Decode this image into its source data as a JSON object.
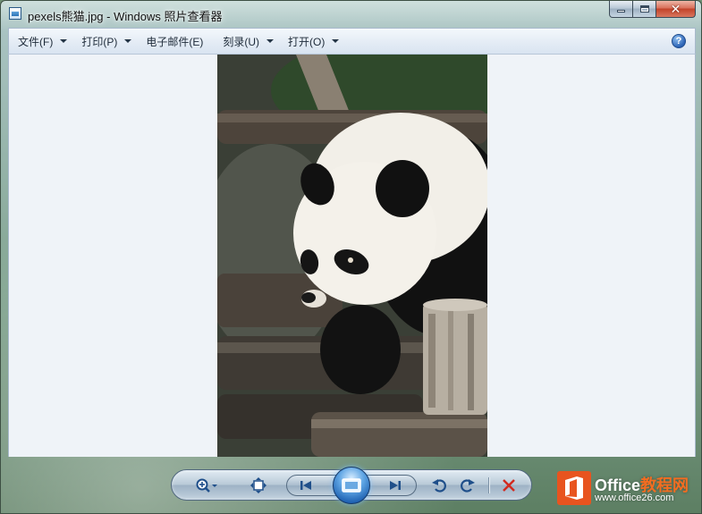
{
  "window": {
    "title": "pexels熊猫.jpg - Windows 照片查看器",
    "app_icon": "photo-viewer-icon",
    "caption_buttons": {
      "minimize": "minimize-icon",
      "maximize": "maximize-icon",
      "close": "close-icon"
    }
  },
  "menubar": {
    "items": [
      {
        "label": "文件(F)",
        "has_dropdown": true
      },
      {
        "label": "打印(P)",
        "has_dropdown": true
      },
      {
        "label": "电子邮件(E)",
        "has_dropdown": false
      },
      {
        "label": "刻录(U)",
        "has_dropdown": true
      },
      {
        "label": "打开(O)",
        "has_dropdown": true
      }
    ],
    "help_label": "?"
  },
  "viewer": {
    "image_subject": "giant panda resting on wooden logs",
    "background_color": "#eff3f8"
  },
  "controls": {
    "zoom": "zoom-icon",
    "actual_size": "fit-to-window-icon",
    "previous": "previous-icon",
    "slideshow": "slideshow-icon",
    "next": "next-icon",
    "rotate_ccw": "rotate-counterclockwise-icon",
    "rotate_cw": "rotate-clockwise-icon",
    "delete": "delete-icon"
  },
  "watermark": {
    "brand_prefix": "Office",
    "brand_suffix": "教程网",
    "url": "www.office26.com",
    "accent_color": "#e8541f"
  }
}
